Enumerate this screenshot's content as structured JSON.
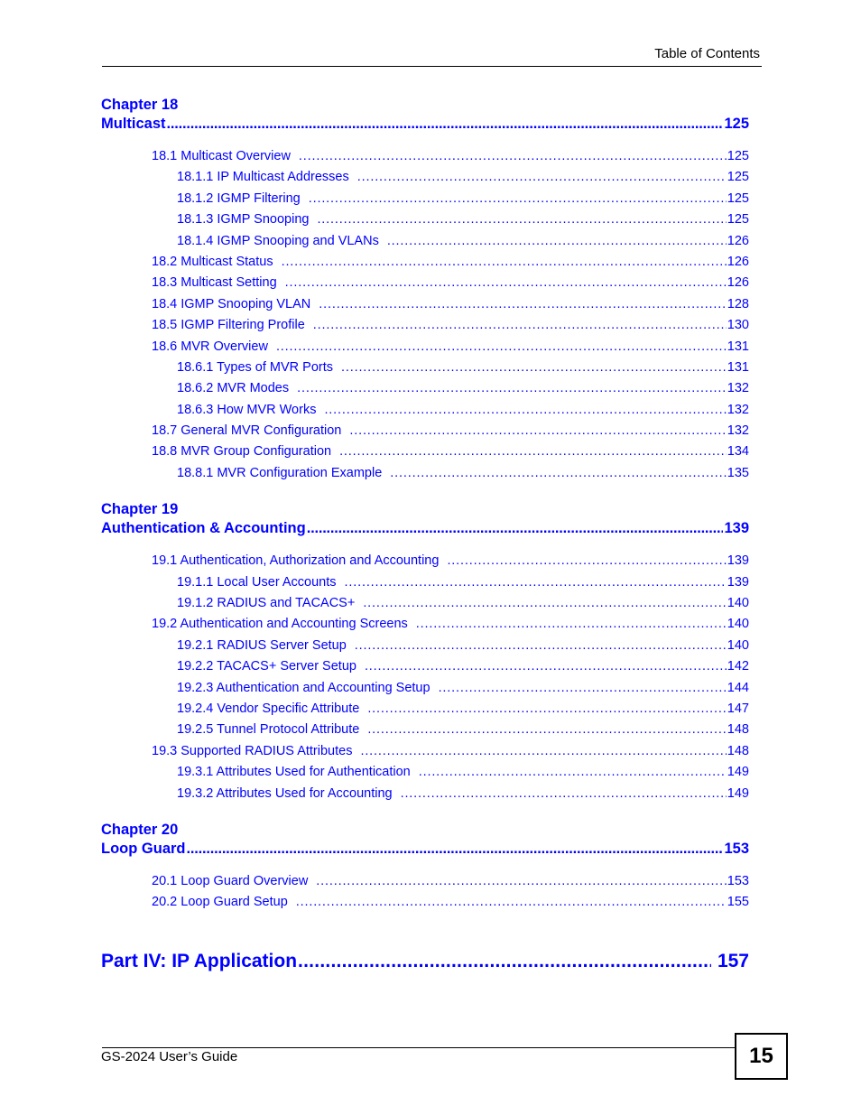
{
  "header": {
    "title": "Table of Contents"
  },
  "toc": {
    "chapters": [
      {
        "label": "Chapter  18",
        "title": "Multicast",
        "page": "125",
        "entries": [
          {
            "level": 1,
            "text": "18.1 Multicast Overview",
            "page": "125"
          },
          {
            "level": 2,
            "text": "18.1.1 IP Multicast Addresses",
            "page": "125"
          },
          {
            "level": 2,
            "text": "18.1.2 IGMP Filtering",
            "page": "125"
          },
          {
            "level": 2,
            "text": "18.1.3 IGMP Snooping",
            "page": "125"
          },
          {
            "level": 2,
            "text": "18.1.4 IGMP Snooping and VLANs",
            "page": "126"
          },
          {
            "level": 1,
            "text": "18.2 Multicast Status",
            "page": "126"
          },
          {
            "level": 1,
            "text": "18.3 Multicast Setting",
            "page": "126"
          },
          {
            "level": 1,
            "text": "18.4 IGMP Snooping VLAN",
            "page": "128"
          },
          {
            "level": 1,
            "text": "18.5 IGMP Filtering Profile",
            "page": "130"
          },
          {
            "level": 1,
            "text": "18.6 MVR Overview",
            "page": "131"
          },
          {
            "level": 2,
            "text": "18.6.1 Types of MVR Ports",
            "page": "131"
          },
          {
            "level": 2,
            "text": "18.6.2 MVR Modes",
            "page": "132"
          },
          {
            "level": 2,
            "text": "18.6.3 How MVR Works",
            "page": "132"
          },
          {
            "level": 1,
            "text": "18.7 General MVR Configuration",
            "page": "132"
          },
          {
            "level": 1,
            "text": "18.8 MVR Group Configuration",
            "page": "134"
          },
          {
            "level": 2,
            "text": "18.8.1 MVR Configuration Example",
            "page": "135"
          }
        ]
      },
      {
        "label": "Chapter  19",
        "title": "Authentication & Accounting",
        "page": "139",
        "entries": [
          {
            "level": 1,
            "text": "19.1 Authentication, Authorization and Accounting",
            "page": "139"
          },
          {
            "level": 2,
            "text": "19.1.1 Local User Accounts",
            "page": "139"
          },
          {
            "level": 2,
            "text": "19.1.2 RADIUS and TACACS+",
            "page": "140"
          },
          {
            "level": 1,
            "text": "19.2 Authentication and Accounting Screens",
            "page": "140"
          },
          {
            "level": 2,
            "text": "19.2.1 RADIUS Server Setup",
            "page": "140"
          },
          {
            "level": 2,
            "text": "19.2.2 TACACS+ Server Setup",
            "page": "142"
          },
          {
            "level": 2,
            "text": "19.2.3 Authentication and Accounting Setup",
            "page": "144"
          },
          {
            "level": 2,
            "text": "19.2.4 Vendor Specific Attribute",
            "page": "147"
          },
          {
            "level": 2,
            "text": "19.2.5 Tunnel Protocol Attribute",
            "page": "148"
          },
          {
            "level": 1,
            "text": "19.3 Supported RADIUS Attributes",
            "page": "148"
          },
          {
            "level": 2,
            "text": "19.3.1 Attributes Used for Authentication",
            "page": "149"
          },
          {
            "level": 2,
            "text": "19.3.2 Attributes Used for Accounting",
            "page": "149"
          }
        ]
      },
      {
        "label": "Chapter  20",
        "title": "Loop Guard",
        "page": "153",
        "entries": [
          {
            "level": 1,
            "text": "20.1 Loop Guard Overview",
            "page": "153"
          },
          {
            "level": 1,
            "text": "20.2 Loop Guard Setup",
            "page": "155"
          }
        ]
      }
    ],
    "part": {
      "title": "Part IV: IP Application",
      "page": "157"
    }
  },
  "footer": {
    "title": "GS-2024 User’s Guide",
    "page_number": "15"
  }
}
